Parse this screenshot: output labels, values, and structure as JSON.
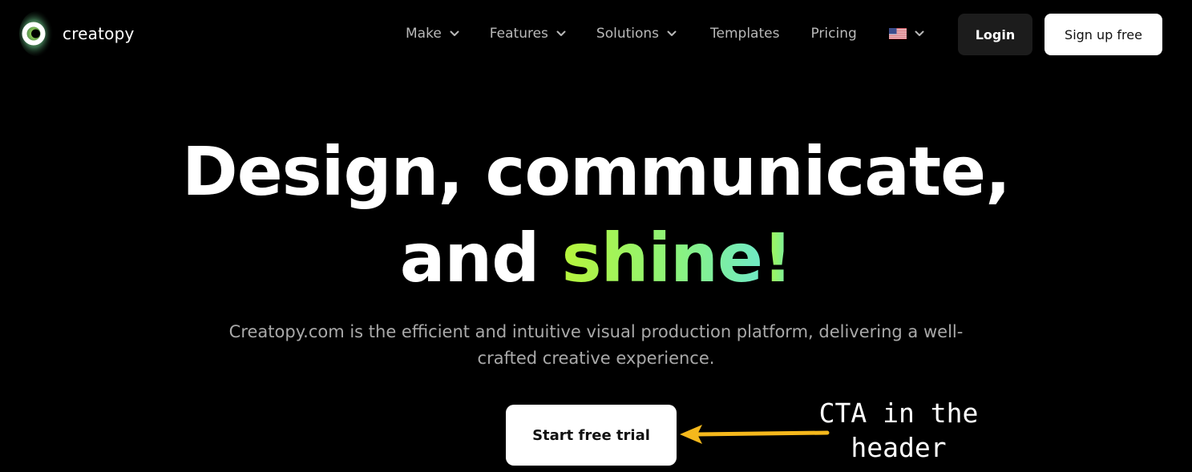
{
  "brand": {
    "name": "creatopy",
    "logo_icon": "creatopy-ring-logo"
  },
  "nav": {
    "items": [
      {
        "label": "Make",
        "has_dropdown": true
      },
      {
        "label": "Features",
        "has_dropdown": true
      },
      {
        "label": "Solutions",
        "has_dropdown": true
      },
      {
        "label": "Templates",
        "has_dropdown": false
      },
      {
        "label": "Pricing",
        "has_dropdown": false
      }
    ],
    "language_icon": "us-flag-icon",
    "login_label": "Login",
    "signup_label": "Sign up free"
  },
  "hero": {
    "title_line1": "Design, communicate,",
    "title_line2_prefix": "and",
    "title_accent": "shine",
    "title_suffix": "!",
    "subtitle": "Creatopy.com is the efficient and intuitive visual production platform, delivering a well-crafted creative experience.",
    "cta_label": "Start free trial"
  },
  "annotation": {
    "line1": "CTA in the",
    "line2": "header"
  },
  "colors": {
    "background": "#000000",
    "accent_start": "#b7f53b",
    "accent_end": "#6fe9c6",
    "arrow": "#f5b81c",
    "login_bg": "#1c1c1c",
    "button_bg": "#ffffff"
  }
}
